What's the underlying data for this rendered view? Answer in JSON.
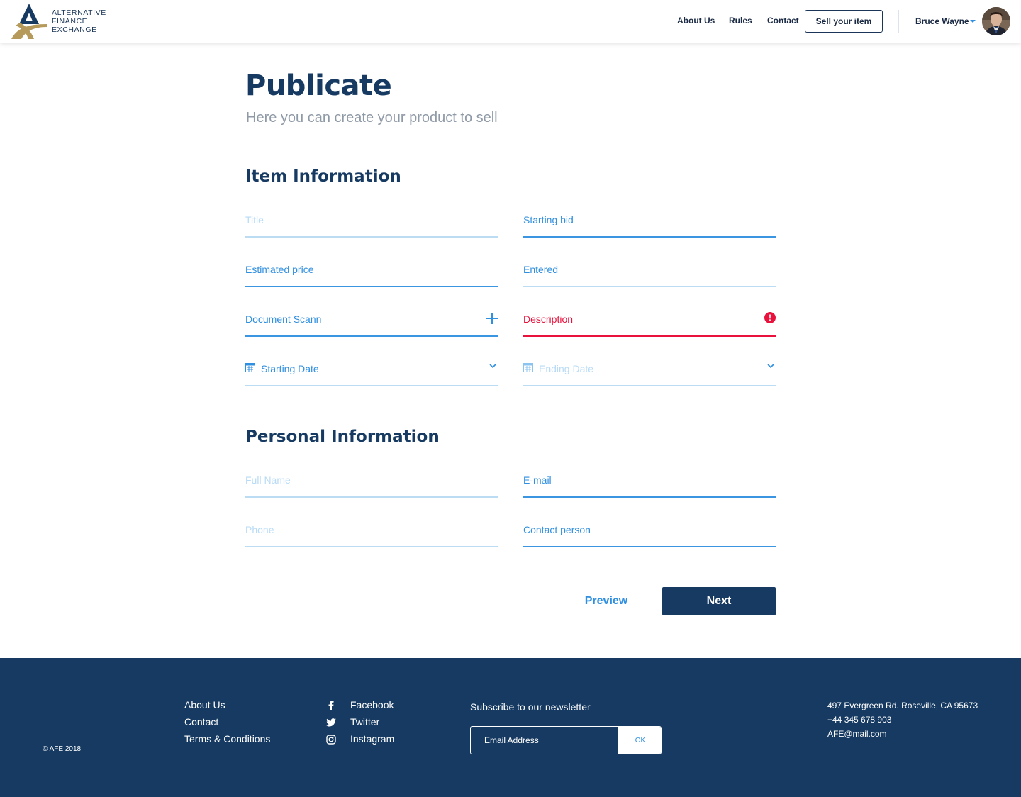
{
  "brand": {
    "line1": "ALTERNATIVE",
    "line2": "FINANCE",
    "line3": "EXCHANGE",
    "colors": {
      "navy": "#163a61",
      "gold": "#b59a5b",
      "accent": "#2f8fe0",
      "error": "#e8123c"
    }
  },
  "nav": {
    "about": "About Us",
    "rules": "Rules",
    "contact": "Contact",
    "sell": "Sell your item"
  },
  "user": {
    "name": "Bruce Wayne"
  },
  "page": {
    "title": "Publicate",
    "subtitle": "Here you can create your product to sell"
  },
  "item_section": {
    "title": "Item Information",
    "title_placeholder": "Title",
    "starting_bid": "Starting bid",
    "estimated_price": "Estimated price",
    "entered_value": "Entered",
    "document_scan": "Document Scann",
    "description": "Description",
    "starting_date": "Starting Date",
    "ending_date": "Ending Date"
  },
  "personal_section": {
    "title": "Personal Information",
    "full_name": "Full Name",
    "email": "E-mail",
    "phone": "Phone",
    "contact_person": "Contact person"
  },
  "actions": {
    "preview": "Preview",
    "next": "Next"
  },
  "footer": {
    "copyright": "© AFE 2018",
    "links": {
      "about": "About Us",
      "contact": "Contact",
      "terms": "Terms & Conditions"
    },
    "social": {
      "facebook": "Facebook",
      "twitter": "Twitter",
      "instagram": "Instagram"
    },
    "newsletter": {
      "title": "Subscribe to our newsletter",
      "placeholder": "Email Address",
      "ok": "OK"
    },
    "address": "497 Evergreen Rd. Roseville, CA 95673",
    "phone": "+44 345 678 903",
    "email": "AFE@mail.com"
  }
}
